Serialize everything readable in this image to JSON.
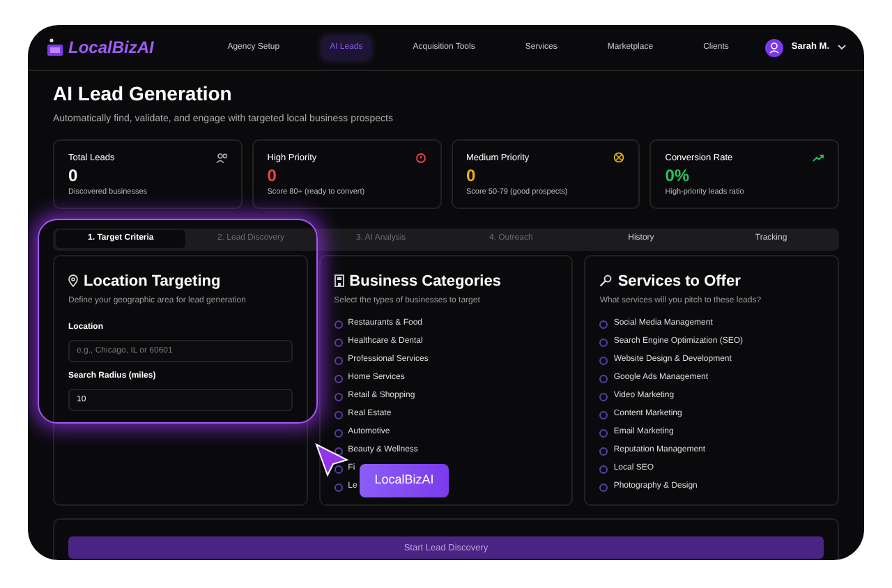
{
  "brand": "LocalBizAI",
  "nav": [
    {
      "label": "Agency Setup",
      "selected": false
    },
    {
      "label": "AI Leads",
      "selected": true
    },
    {
      "label": "Acquisition Tools",
      "selected": false
    },
    {
      "label": "Services",
      "selected": false
    },
    {
      "label": "Marketplace",
      "selected": false
    },
    {
      "label": "Clients",
      "selected": false
    }
  ],
  "user": {
    "name": "Sarah M."
  },
  "page": {
    "title": "AI Lead Generation",
    "subtitle": "Automatically find, validate, and engage with targeted local business prospects"
  },
  "stats": [
    {
      "label": "Total Leads",
      "value": "0",
      "note": "Discovered businesses",
      "color": "#ffffff"
    },
    {
      "label": "High Priority",
      "value": "0",
      "note": "Score 80+ (ready to convert)",
      "color": "#ef4444"
    },
    {
      "label": "Medium Priority",
      "value": "0",
      "note": "Score 50-79 (good prospects)",
      "color": "#eab308"
    },
    {
      "label": "Conversion Rate",
      "value": "0%",
      "note": "High-priority leads ratio",
      "color": "#22c55e"
    }
  ],
  "tabs": [
    {
      "label": "1. Target Criteria",
      "selected": true,
      "disabled": false
    },
    {
      "label": "2. Lead Discovery",
      "selected": false,
      "disabled": true
    },
    {
      "label": "3. AI Analysis",
      "selected": false,
      "disabled": true
    },
    {
      "label": "4. Outreach",
      "selected": false,
      "disabled": true
    },
    {
      "label": "History",
      "selected": false,
      "disabled": false
    },
    {
      "label": "Tracking",
      "selected": false,
      "disabled": false
    }
  ],
  "location": {
    "title": "Location Targeting",
    "subtitle": "Define your geographic area for lead generation",
    "fields": [
      {
        "label": "Location",
        "placeholder": "e.g., Chicago, IL or 60601"
      },
      {
        "label": "Search Radius (miles)",
        "value": "10"
      }
    ]
  },
  "categories": {
    "title": "Business Categories",
    "subtitle": "Select the types of businesses to target",
    "items": [
      {
        "label": "Restaurants & Food",
        "checked": false
      },
      {
        "label": "Healthcare & Dental",
        "checked": false
      },
      {
        "label": "Professional Services",
        "checked": false
      },
      {
        "label": "Home Services",
        "checked": false
      },
      {
        "label": "Retail & Shopping",
        "checked": false
      },
      {
        "label": "Real Estate",
        "checked": false
      },
      {
        "label": "Automotive",
        "checked": false
      },
      {
        "label": "Beauty & Wellness",
        "checked": false
      },
      {
        "label": "Fi",
        "checked": false
      },
      {
        "label": "Le",
        "checked": false
      }
    ]
  },
  "services": {
    "title": "Services to Offer",
    "subtitle": "What services will you pitch to these leads?",
    "items": [
      {
        "label": "Social Media Management",
        "checked": false
      },
      {
        "label": "Search Engine Optimization (SEO)",
        "checked": false
      },
      {
        "label": "Website Design & Development",
        "checked": false
      },
      {
        "label": "Google Ads Management",
        "checked": false
      },
      {
        "label": "Video Marketing",
        "checked": false
      },
      {
        "label": "Content Marketing",
        "checked": false
      },
      {
        "label": "Email Marketing",
        "checked": false
      },
      {
        "label": "Reputation Management",
        "checked": false
      },
      {
        "label": "Local SEO",
        "checked": false
      },
      {
        "label": "Photography & Design",
        "checked": false
      }
    ]
  },
  "action": {
    "label": "Start Lead Discovery"
  },
  "cursor_label": "LocalBizAI"
}
